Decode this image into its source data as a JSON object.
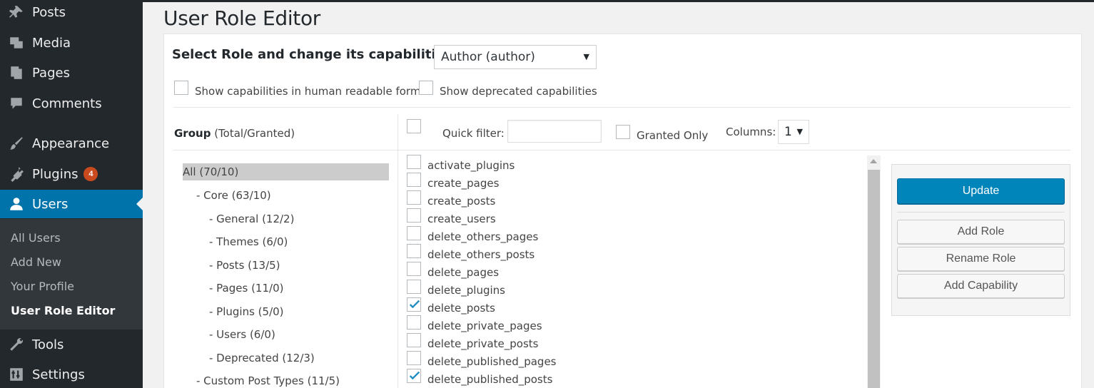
{
  "sidebar": {
    "menu": [
      {
        "label": "Posts",
        "icon": "pin-icon"
      },
      {
        "label": "Media",
        "icon": "media-icon"
      },
      {
        "label": "Pages",
        "icon": "pages-icon"
      },
      {
        "label": "Comments",
        "icon": "comment-icon"
      },
      {
        "label": "Appearance",
        "icon": "brush-icon"
      },
      {
        "label": "Plugins",
        "icon": "plug-icon",
        "badge": "4"
      },
      {
        "label": "Users",
        "icon": "user-icon"
      },
      {
        "label": "Tools",
        "icon": "wrench-icon"
      },
      {
        "label": "Settings",
        "icon": "settings-icon"
      }
    ],
    "submenu": [
      "All Users",
      "Add New",
      "Your Profile",
      "User Role Editor"
    ]
  },
  "page": {
    "title": "User Role Editor",
    "select_label": "Select Role and change its capabilities:",
    "role_value": "Author (author)",
    "human_readable_label": "Show capabilities in human readable form",
    "deprecated_label": "Show deprecated capabilities"
  },
  "groups": {
    "header_bold": "Group",
    "header_rest": " (Total/Granted)",
    "items": [
      "All (70/10)",
      "- Core (63/10)",
      "- General (12/2)",
      "- Themes (6/0)",
      "- Posts (13/5)",
      "- Pages (11/0)",
      "- Plugins (5/0)",
      "- Users (6/0)",
      "- Deprecated (12/3)",
      "- Custom Post Types (11/5)"
    ]
  },
  "filter": {
    "quick_filter_label": "Quick filter:",
    "quick_filter_value": "",
    "granted_only_label": "Granted Only",
    "columns_label": "Columns:",
    "columns_value": "1"
  },
  "capabilities": [
    {
      "name": "activate_plugins",
      "checked": false
    },
    {
      "name": "create_pages",
      "checked": false
    },
    {
      "name": "create_posts",
      "checked": false
    },
    {
      "name": "create_users",
      "checked": false
    },
    {
      "name": "delete_others_pages",
      "checked": false
    },
    {
      "name": "delete_others_posts",
      "checked": false
    },
    {
      "name": "delete_pages",
      "checked": false
    },
    {
      "name": "delete_plugins",
      "checked": false
    },
    {
      "name": "delete_posts",
      "checked": true
    },
    {
      "name": "delete_private_pages",
      "checked": false
    },
    {
      "name": "delete_private_posts",
      "checked": false
    },
    {
      "name": "delete_published_pages",
      "checked": false
    },
    {
      "name": "delete_published_posts",
      "checked": true
    }
  ],
  "actions": {
    "update": "Update",
    "add_role": "Add Role",
    "rename_role": "Rename Role",
    "add_capability": "Add Capability"
  },
  "colors": {
    "sidebar_bg": "#23282d",
    "active_menu": "#0073aa",
    "badge": "#ca4a1f",
    "primary_button": "#0085ba",
    "check_mark": "#1e8cbe"
  }
}
